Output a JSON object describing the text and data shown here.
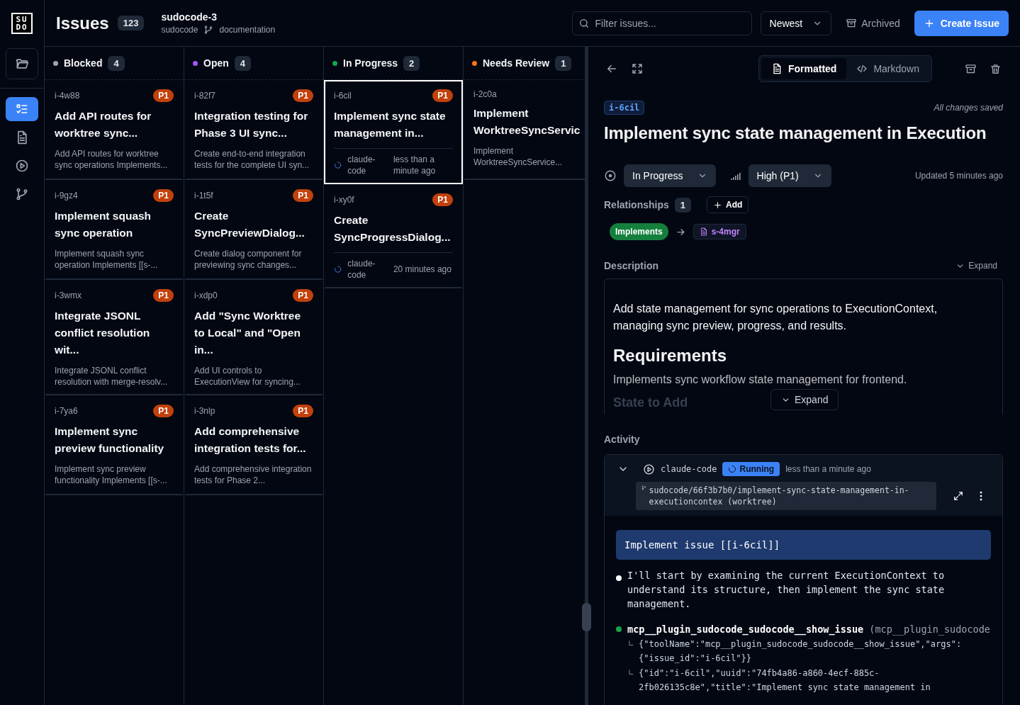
{
  "logo": [
    "SU",
    "DO"
  ],
  "sidebar": {
    "items": [
      {
        "kind": "folder",
        "selected": false
      },
      {
        "kind": "issues",
        "selected": true
      },
      {
        "kind": "document",
        "selected": false
      },
      {
        "kind": "play",
        "selected": false
      },
      {
        "kind": "branch",
        "selected": false
      }
    ]
  },
  "header": {
    "title": "Issues",
    "count": "123",
    "project": "sudocode-3",
    "repo": "sudocode",
    "branch": "documentation",
    "search_placeholder": "Filter issues...",
    "sort": "Newest",
    "archived": "Archived",
    "create": "Create Issue"
  },
  "columns": [
    {
      "name": "Blocked",
      "color": "#9ca3af",
      "count": "4",
      "cards": [
        {
          "id": "i-4w88",
          "priority": "P1",
          "title": "Add API routes for worktree sync...",
          "description": "Add API routes for worktree sync operations Implements...",
          "selected": false
        },
        {
          "id": "i-9gz4",
          "priority": "P1",
          "title": "Implement squash sync operation",
          "description": "Implement squash sync operation Implements [[s-...",
          "selected": false
        },
        {
          "id": "i-3wmx",
          "priority": "P1",
          "title": "Integrate JSONL conflict resolution wit...",
          "description": "Integrate JSONL conflict resolution with merge-resolv...",
          "selected": false
        },
        {
          "id": "i-7ya6",
          "priority": "P1",
          "title": "Implement sync preview functionality",
          "description": "Implement sync preview functionality Implements [[s-...",
          "selected": false
        }
      ]
    },
    {
      "name": "Open",
      "color": "#a855f7",
      "count": "4",
      "cards": [
        {
          "id": "i-82f7",
          "priority": "P1",
          "title": "Integration testing for Phase 3 UI sync...",
          "description": "Create end-to-end integration tests for the complete UI syn...",
          "selected": false
        },
        {
          "id": "i-1t5f",
          "priority": "P1",
          "title": "Create SyncPreviewDialog...",
          "description": "Create dialog component for previewing sync changes...",
          "selected": false
        },
        {
          "id": "i-xdp0",
          "priority": "P1",
          "title": "Add \"Sync Worktree to Local\" and \"Open in...",
          "description": "Add UI controls to ExecutionView for syncing...",
          "selected": false
        },
        {
          "id": "i-3nlp",
          "priority": "P1",
          "title": "Add comprehensive integration tests for...",
          "description": "Add comprehensive integration tests for Phase 2...",
          "selected": false
        }
      ]
    },
    {
      "name": "In Progress",
      "color": "#16a34a",
      "count": "2",
      "cards": [
        {
          "id": "i-6cil",
          "priority": "P1",
          "title": "Implement sync state management in...",
          "agent": "claude-code",
          "time": "less than a minute ago",
          "selected": true
        },
        {
          "id": "i-xy0f",
          "priority": "P1",
          "title": "Create SyncProgressDialog...",
          "agent": "claude-code",
          "time": "20 minutes ago",
          "selected": false
        }
      ]
    },
    {
      "name": "Needs Review",
      "color": "#f97316",
      "count": "1",
      "cards": [
        {
          "id": "i-2c0a",
          "title": "Implement WorktreeSyncServic",
          "description": "Implement WorktreeSyncService...",
          "selected": false
        }
      ]
    }
  ],
  "detail": {
    "view_tabs": [
      {
        "label": "Formatted",
        "kind": "formatted",
        "selected": true
      },
      {
        "label": "Markdown",
        "kind": "markdown",
        "selected": false
      }
    ],
    "id": "i-6cil",
    "save_status": "All changes saved",
    "title": "Implement sync state management in Execution",
    "status": "In Progress",
    "priority": "High (P1)",
    "updated": "Updated 5 minutes ago",
    "relationships": {
      "label": "Relationships",
      "count": "1",
      "add": "Add",
      "items": [
        {
          "type": "Implements",
          "target": "s-4mgr"
        }
      ]
    },
    "description": {
      "label": "Description",
      "expand": "Expand",
      "overlay_expand": "Expand",
      "blocks": [
        {
          "kind": "p",
          "text": "Add state management for sync operations to ExecutionContext, managing sync preview, progress, and results."
        },
        {
          "kind": "h2",
          "text": "Requirements"
        },
        {
          "kind": "p",
          "text": "Implements sync workflow state management for frontend."
        },
        {
          "kind": "h3",
          "text": "State to Add"
        }
      ]
    },
    "activity": {
      "label": "Activity",
      "run": {
        "agent": "claude-code",
        "status": "Running",
        "time": "less than a minute ago",
        "branch": "sudocode/66f3b7b0/implement-sync-state-management-in-executioncontex (worktree)",
        "prompt": "Implement issue [[i-6cil]]",
        "entries": [
          {
            "kind": "message",
            "text": "I'll start by examining the current ExecutionContext to understand its structure, then implement the sync state management."
          },
          {
            "kind": "tool",
            "name": "mcp__plugin_sudocode_sudocode__show_issue",
            "args": "(mcp__plugin_sudocode",
            "results": [
              "{\"toolName\":\"mcp__plugin_sudocode_sudocode__show_issue\",\"args\":{\"issue_id\":\"i-6cil\"}}",
              "{\"id\":\"i-6cil\",\"uuid\":\"74fb4a86-a860-4ecf-885c-2fb026135c8e\",\"title\":\"Implement sync state management in"
            ]
          }
        ]
      }
    }
  }
}
